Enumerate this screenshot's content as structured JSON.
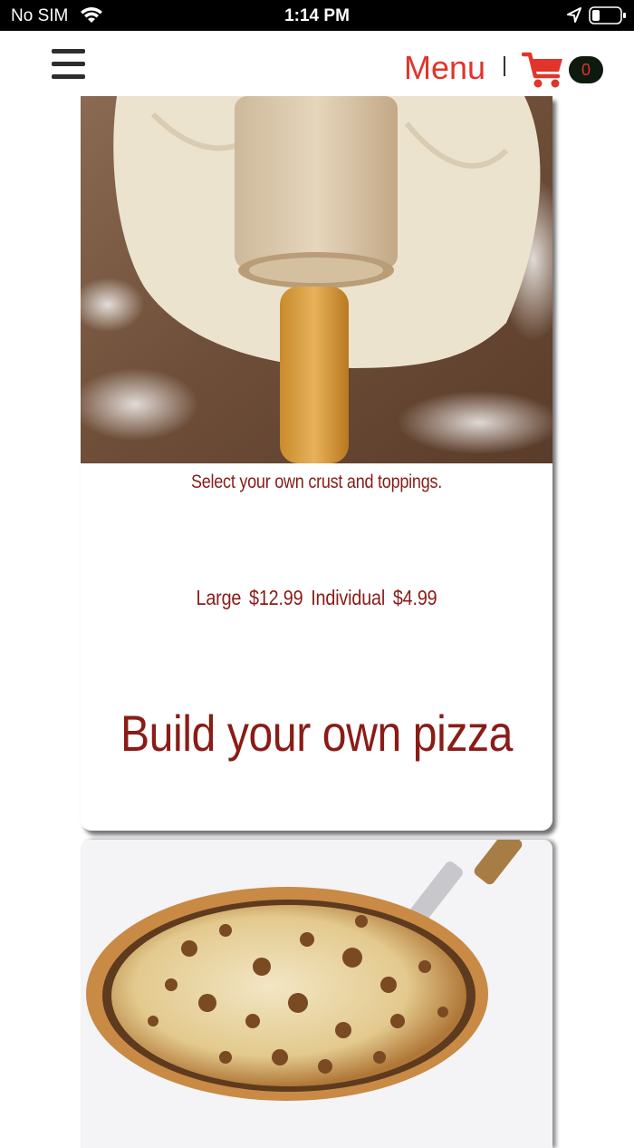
{
  "status_bar": {
    "carrier": "No SIM",
    "time": "1:14 PM"
  },
  "header": {
    "menu_label": "Menu",
    "cart_count": "0",
    "accent_color": "#e2342a"
  },
  "products": [
    {
      "description": "Select your own crust and toppings.",
      "prices": "Large $12.99   Individual  $4.99",
      "title": "Build your own pizza",
      "image_icon": "dough-rolling-pin-photo"
    },
    {
      "image_icon": "meat-pizza-photo"
    }
  ],
  "colors": {
    "title_red": "#8a1c17",
    "badge_bg": "#0f1a0f"
  }
}
